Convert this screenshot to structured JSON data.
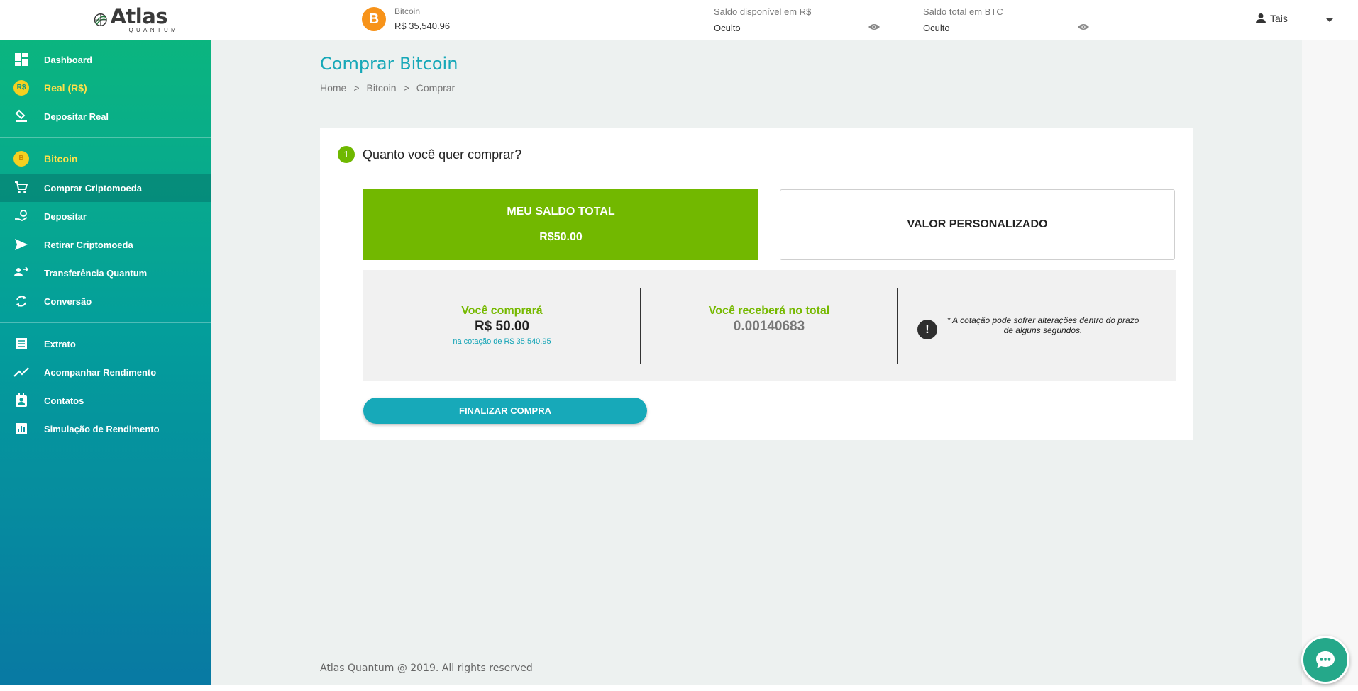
{
  "header": {
    "logo_main": "Atlas",
    "logo_sub": "QUANTUM",
    "btc_symbol": "B",
    "coin_name": "Bitcoin",
    "coin_price": "R$ 35,540.96",
    "balance_brl_label": "Saldo disponível em R$",
    "balance_brl_value": "Oculto",
    "balance_btc_label": "Saldo total em BTC",
    "balance_btc_value": "Oculto",
    "user_name": "Tais"
  },
  "sidebar": {
    "group1": [
      {
        "label": "Dashboard",
        "icon": "dashboard-icon"
      },
      {
        "label": "Real (R$)",
        "icon": "real-coin-icon",
        "coin_text": "R$"
      },
      {
        "label": "Depositar Real",
        "icon": "deposit-icon"
      }
    ],
    "group2": [
      {
        "label": "Bitcoin",
        "icon": "bitcoin-coin-icon",
        "coin_text": "B"
      },
      {
        "label": "Comprar Criptomoeda",
        "icon": "cart-icon"
      },
      {
        "label": "Depositar",
        "icon": "hand-deposit-icon"
      },
      {
        "label": "Retirar Criptomoeda",
        "icon": "send-icon"
      },
      {
        "label": "Transferência Quantum",
        "icon": "transfer-icon"
      },
      {
        "label": "Conversão",
        "icon": "convert-icon"
      }
    ],
    "group3": [
      {
        "label": "Extrato",
        "icon": "statement-icon"
      },
      {
        "label": "Acompanhar Rendimento",
        "icon": "trend-icon"
      },
      {
        "label": "Contatos",
        "icon": "contacts-icon"
      },
      {
        "label": "Simulação de Rendimento",
        "icon": "chart-icon"
      }
    ]
  },
  "page": {
    "title": "Comprar Bitcoin",
    "breadcrumb": [
      "Home",
      ">",
      "Bitcoin",
      ">",
      "Comprar"
    ]
  },
  "step": {
    "number": "1",
    "question": "Quanto você quer comprar?"
  },
  "options": {
    "total_title": "MEU SALDO TOTAL",
    "total_value": "R$50.00",
    "custom_title": "VALOR PERSONALIZADO"
  },
  "summary": {
    "buy_title": "Você comprará",
    "buy_value": "R$ 50.00",
    "buy_rate": "na cotação de R$ 35,540.95",
    "receive_title": "Você receberá no total",
    "receive_value": "0.00140683",
    "warning_symbol": "!",
    "note": "* A cotação pode sofrer alterações dentro do prazo de alguns segundos."
  },
  "actions": {
    "finalize_label": "FINALIZAR COMPRA"
  },
  "footer": {
    "text": "Atlas Quantum @ 2019. All rights reserved"
  },
  "colors": {
    "accent_teal": "#16a8b8",
    "accent_green": "#72b800",
    "sidebar_top": "#0bb57f",
    "sidebar_bottom": "#0879a3",
    "bitcoin_orange": "#f7931a"
  }
}
